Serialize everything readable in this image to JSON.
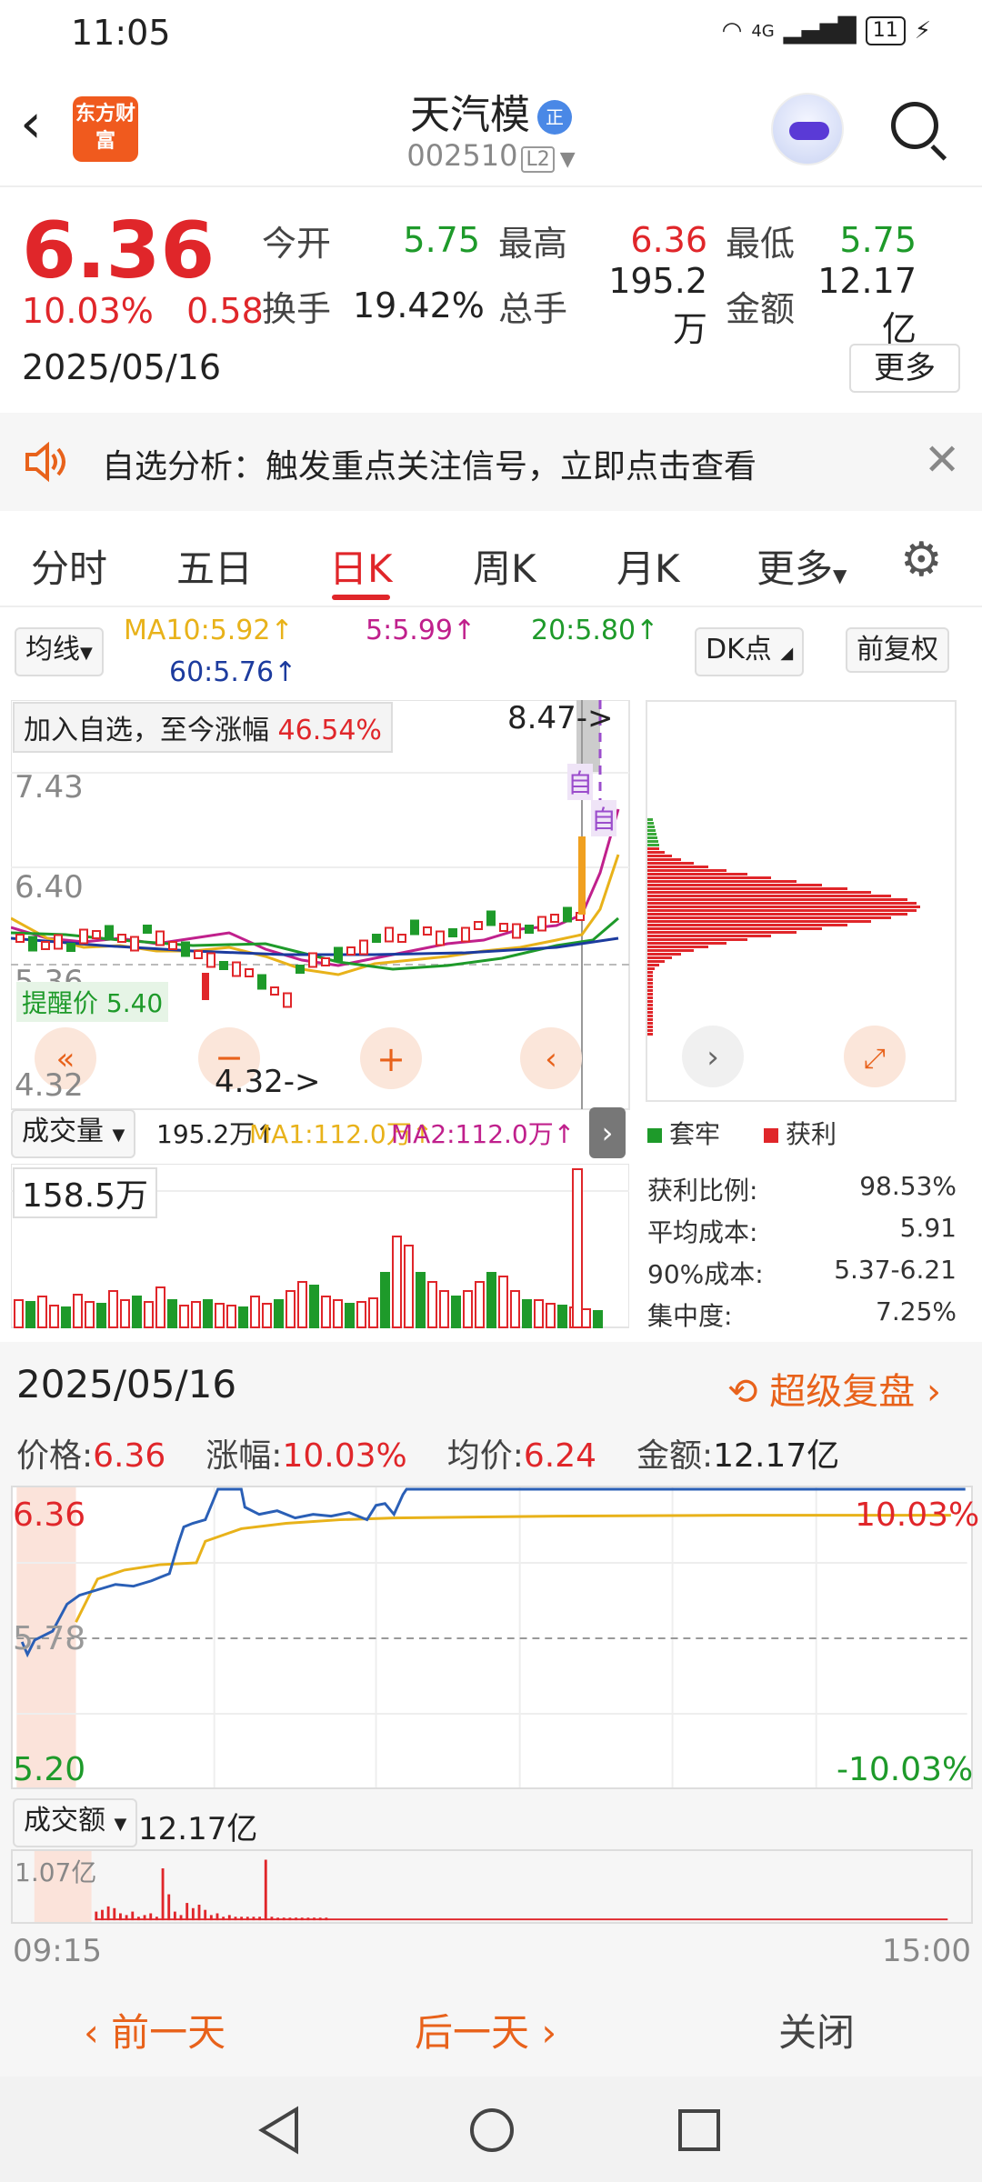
{
  "status": {
    "time": "11:05",
    "signal": "4G",
    "battery": "11"
  },
  "nav": {
    "logo_text": "东方财富",
    "title": "天汽模",
    "badge": "正",
    "code": "002510",
    "level": "L2"
  },
  "quote": {
    "price": "6.36",
    "change_pct": "10.03%",
    "change": "0.58",
    "date": "2025/05/16",
    "open_label": "今开",
    "open": "5.75",
    "high_label": "最高",
    "high": "6.36",
    "low_label": "最低",
    "low": "5.75",
    "turnover_label": "换手",
    "turnover": "19.42%",
    "volume_label": "总手",
    "volume": "195.2万",
    "amount_label": "金额",
    "amount": "12.17亿",
    "more_label": "更多"
  },
  "notice": {
    "text": "自选分析：触发重点关注信号，立即点击查看"
  },
  "tabs": {
    "items": [
      "分时",
      "五日",
      "日K",
      "周K",
      "月K",
      "更多"
    ],
    "active": "日K"
  },
  "kline": {
    "ma_selector": "均线",
    "ma10": "MA10:5.92↑",
    "ma5": "5:5.99↑",
    "ma20": "20:5.80↑",
    "ma60": "60:5.76↑",
    "dk_label": "DK点",
    "fq_label": "前复权",
    "added_note": "加入自选，至今涨幅",
    "added_pct": "46.54%",
    "top_mark": "8.47->",
    "low_mark": "4.32->",
    "remind": "提醒价 5.40",
    "mark_zi": "自",
    "ytick_top": "7.43",
    "ytick_mid": "6.40",
    "ytick_low": "5.36",
    "ytick_bottom": "4.32",
    "vol_selector": "成交量",
    "vol_text": "195.2万↑",
    "vol_ma1": "MA1:112.0万↑",
    "vol_ma2": "MA2:112.0万↑",
    "vol_max": "158.5万"
  },
  "chip": {
    "legend_trap": "套牢",
    "legend_profit": "获利",
    "rows": [
      {
        "k": "获利比例:",
        "v": "98.53%"
      },
      {
        "k": "平均成本:",
        "v": "5.91"
      },
      {
        "k": "90%成本:",
        "v": "5.37-6.21"
      },
      {
        "k": "集中度:",
        "v": "7.25%"
      }
    ]
  },
  "intraday": {
    "date": "2025/05/16",
    "super_replay": "超级复盘",
    "price_label": "价格:",
    "price": "6.36",
    "pct_label": "涨幅:",
    "pct": "10.03%",
    "avg_label": "均价:",
    "avg": "6.24",
    "amount_label": "金额:",
    "amount": "12.17亿",
    "y_top": "6.36",
    "y_mid": "5.78",
    "y_bottom": "5.20",
    "pct_top": "10.03%",
    "pct_bottom": "-10.03%",
    "amt_selector": "成交额",
    "amt_value": "12.17亿",
    "amt_max": "1.07亿",
    "t_start": "09:15",
    "t_end": "15:00"
  },
  "bottom": {
    "prev": "前一天",
    "next": "后一天",
    "close": "关闭"
  },
  "colors": {
    "up": "#e0262a",
    "down": "#1e9a2a",
    "accent": "#e8621b"
  }
}
